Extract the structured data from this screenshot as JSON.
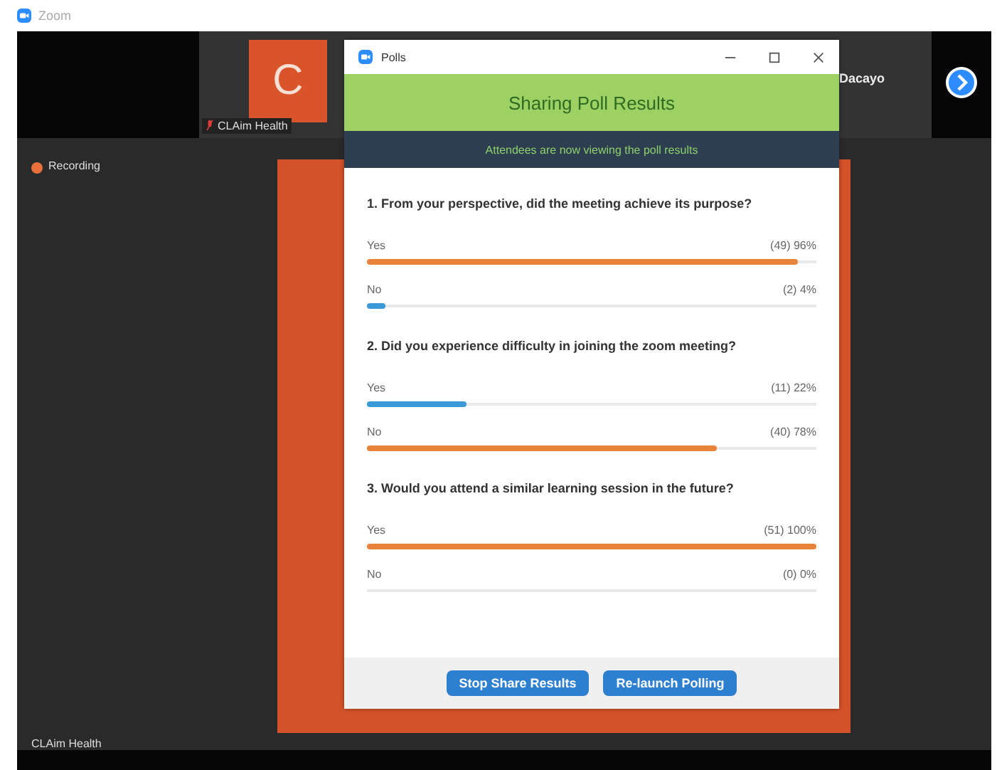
{
  "app_title": "Zoom",
  "participants": [
    {
      "initial": "C",
      "name": "CLAim Health"
    },
    {
      "name": "Dacayo"
    }
  ],
  "recording": "Recording",
  "bottom_name": "CLAim Health",
  "poll_window": {
    "title": "Polls",
    "header": "Sharing Poll Results",
    "notice": "Attendees are now viewing the poll results",
    "questions": [
      {
        "text": "1. From your perspective, did the meeting achieve its purpose?",
        "options": [
          {
            "label": "Yes",
            "result": "(49) 96%",
            "level": 0.96,
            "color": "#e8843a"
          },
          {
            "label": "No",
            "result": "(2) 4%",
            "level": 0.04,
            "color": "#3a9ad9"
          }
        ]
      },
      {
        "text": "2. Did you experience difficulty in joining the zoom meeting?",
        "options": [
          {
            "label": "Yes",
            "result": "(11) 22%",
            "level": 0.22,
            "color": "#3a9ad9"
          },
          {
            "label": "No",
            "result": "(40) 78%",
            "level": 0.78,
            "color": "#e8843a"
          }
        ]
      },
      {
        "text": "3. Would you attend a similar learning session in the future?",
        "options": [
          {
            "label": "Yes",
            "result": "(51) 100%",
            "level": 1,
            "color": "#e8843a"
          },
          {
            "label": "No",
            "result": "(0) 0%"
          }
        ]
      }
    ],
    "buttons": [
      "Stop Share Results",
      "Re-launch Polling"
    ]
  }
}
